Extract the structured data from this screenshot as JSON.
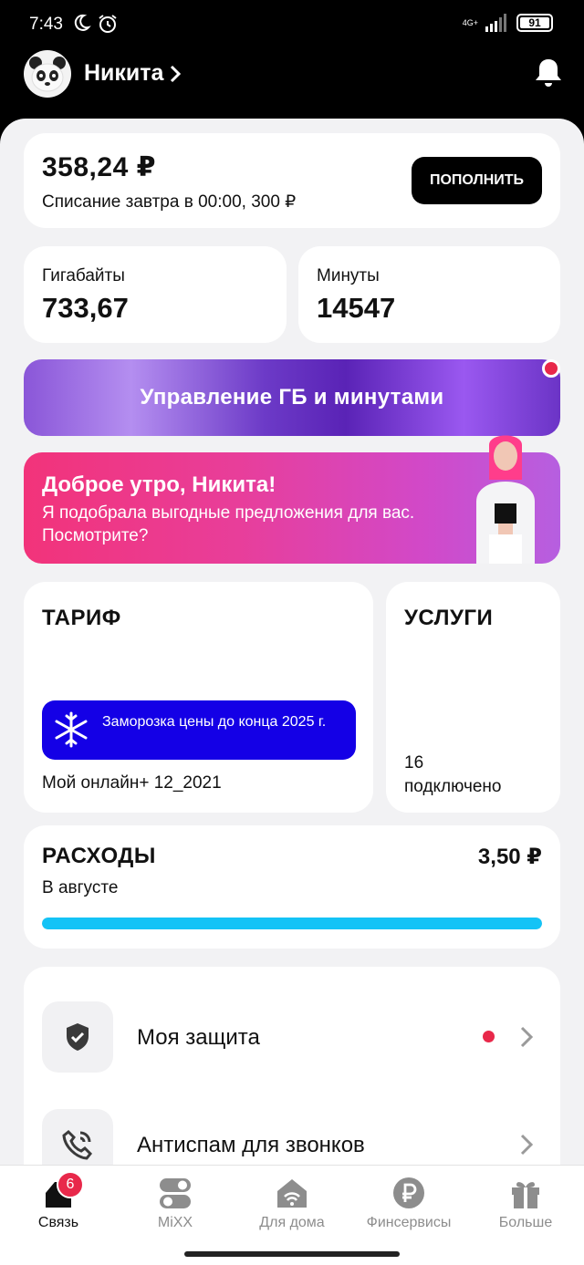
{
  "status_bar": {
    "time": "7:43",
    "network": "4G+",
    "battery": "91"
  },
  "header": {
    "user_name": "Никита"
  },
  "balance": {
    "amount": "358,24 ₽",
    "note": "Списание завтра в 00:00, 300 ₽",
    "topup_label": "ПОПОЛНИТЬ"
  },
  "stats": {
    "gb_label": "Гигабайты",
    "gb_value": "733,67",
    "min_label": "Минуты",
    "min_value": "14547"
  },
  "manage_banner": {
    "label": "Управление ГБ и минутами"
  },
  "promo": {
    "title": "Доброе утро, Никита!",
    "text": "Я подобрала выгодные предложения для вас. Посмотрите?"
  },
  "tariff": {
    "heading": "ТАРИФ",
    "freeze_text": "Заморозка цены до конца 2025 г.",
    "name": "Мой онлайн+ 12_2021"
  },
  "services": {
    "heading": "УСЛУГИ",
    "count": "16",
    "count_label": "подключено"
  },
  "expenses": {
    "title": "РАСХОДЫ",
    "amount": "3,50 ₽",
    "period": "В августе",
    "progress_fraction": 1.0
  },
  "list": [
    {
      "label": "Моя защита",
      "icon": "shield-check-icon",
      "has_dot": true
    },
    {
      "label": "Антиспам для звонков",
      "icon": "phone-ringing-icon",
      "has_dot": false
    }
  ],
  "bottom_nav": [
    {
      "label": "Связь",
      "icon": "sim-card-icon",
      "active": true,
      "badge": "6"
    },
    {
      "label": "MiXX",
      "icon": "mixx-icon",
      "active": false
    },
    {
      "label": "Для дома",
      "icon": "home-wifi-icon",
      "active": false
    },
    {
      "label": "Финсервисы",
      "icon": "ruble-icon",
      "active": false
    },
    {
      "label": "Больше",
      "icon": "gift-icon",
      "active": false
    }
  ],
  "colors": {
    "accent_blue": "#1400e6",
    "progress": "#14c3f6",
    "alert_red": "#e8284a"
  }
}
